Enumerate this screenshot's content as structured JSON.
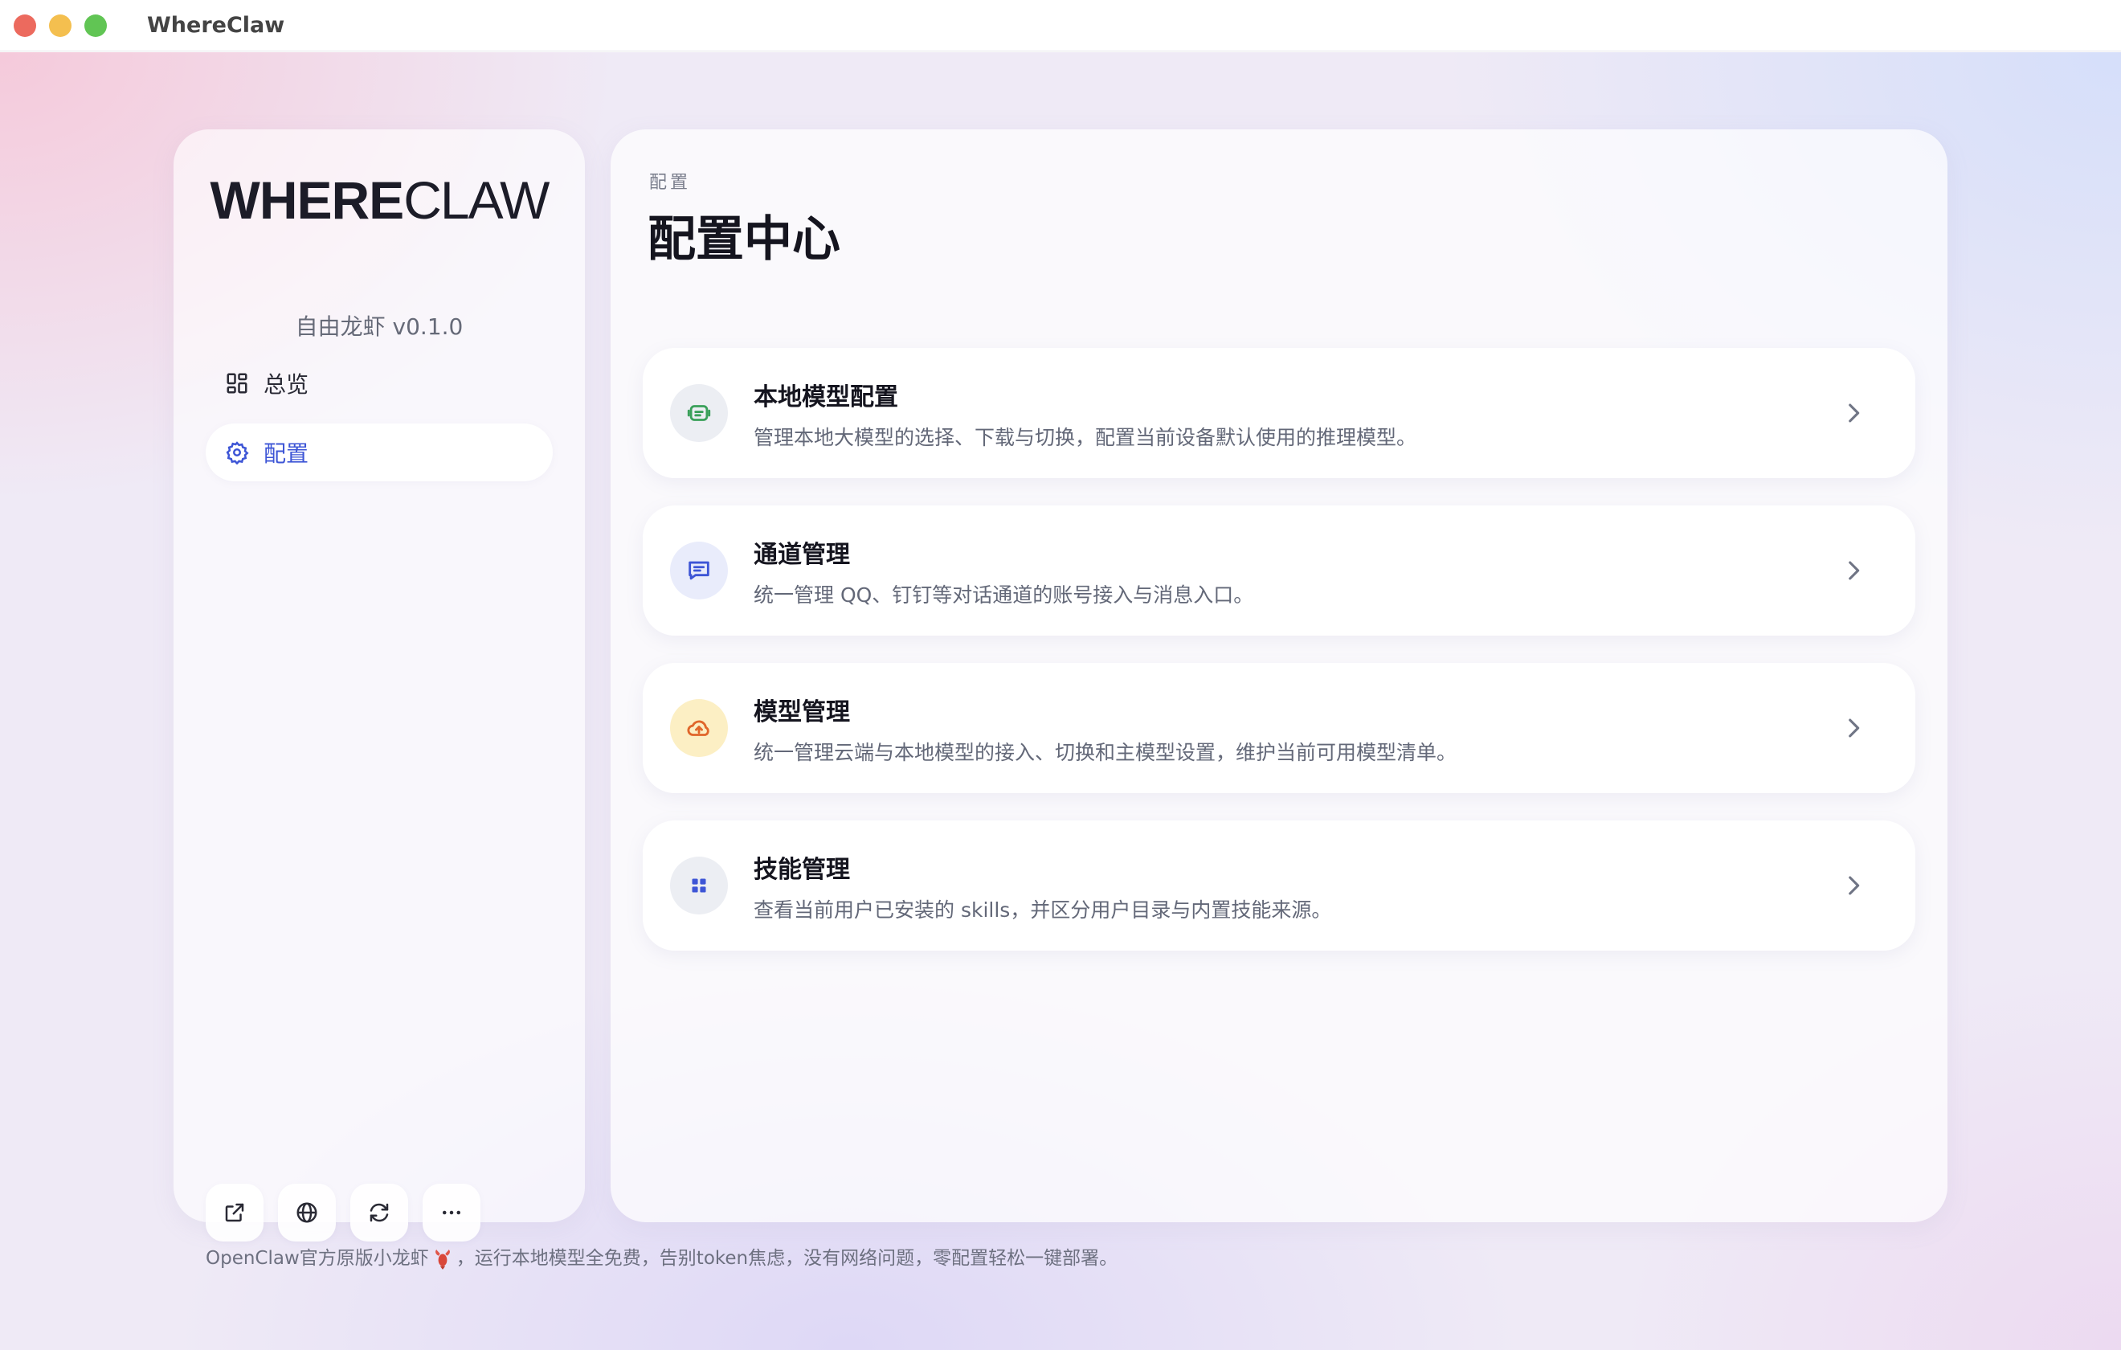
{
  "window": {
    "title": "WhereClaw",
    "controls": [
      "close",
      "minimize",
      "zoom"
    ]
  },
  "sidebar": {
    "logo_bold": "WHERE",
    "logo_light": "CLAW",
    "version": "自由龙虾 v0.1.0",
    "items": [
      {
        "label": "总览",
        "icon": "grid-icon",
        "active": false
      },
      {
        "label": "配置",
        "icon": "gear-icon",
        "active": true
      }
    ],
    "tools": [
      {
        "icon": "external-link-icon"
      },
      {
        "icon": "globe-icon"
      },
      {
        "icon": "refresh-icon"
      },
      {
        "icon": "more-icon"
      }
    ]
  },
  "main": {
    "breadcrumb": "配置",
    "title": "配置中心",
    "cards": [
      {
        "title": "本地模型配置",
        "desc": "管理本地大模型的选择、下载与切换，配置当前设备默认使用的推理模型。",
        "icon": "chip-icon",
        "icon_color": "#3aa05a",
        "icon_bg": "#eceef3"
      },
      {
        "title": "通道管理",
        "desc": "统一管理 QQ、钉钉等对话通道的账号接入与消息入口。",
        "icon": "chat-icon",
        "icon_color": "#3d55d6",
        "icon_bg": "#e9ecfb"
      },
      {
        "title": "模型管理",
        "desc": "统一管理云端与本地模型的接入、切换和主模型设置，维护当前可用模型清单。",
        "icon": "cloud-upload-icon",
        "icon_color": "#e0662a",
        "icon_bg": "#fcefc4"
      },
      {
        "title": "技能管理",
        "desc": "查看当前用户已安装的 skills，并区分用户目录与内置技能来源。",
        "icon": "apps-icon",
        "icon_color": "#3d55d6",
        "icon_bg": "#eceef3"
      }
    ]
  },
  "footer": {
    "text_before": "OpenClaw官方原版小龙虾",
    "emoji": "lobster-icon",
    "text_after": "，运行本地模型全免费，告别token焦虑，没有网络问题，零配置轻松一键部署。"
  },
  "colors": {
    "accent": "#3d55d6",
    "title": "#15151f",
    "muted": "#636878"
  }
}
